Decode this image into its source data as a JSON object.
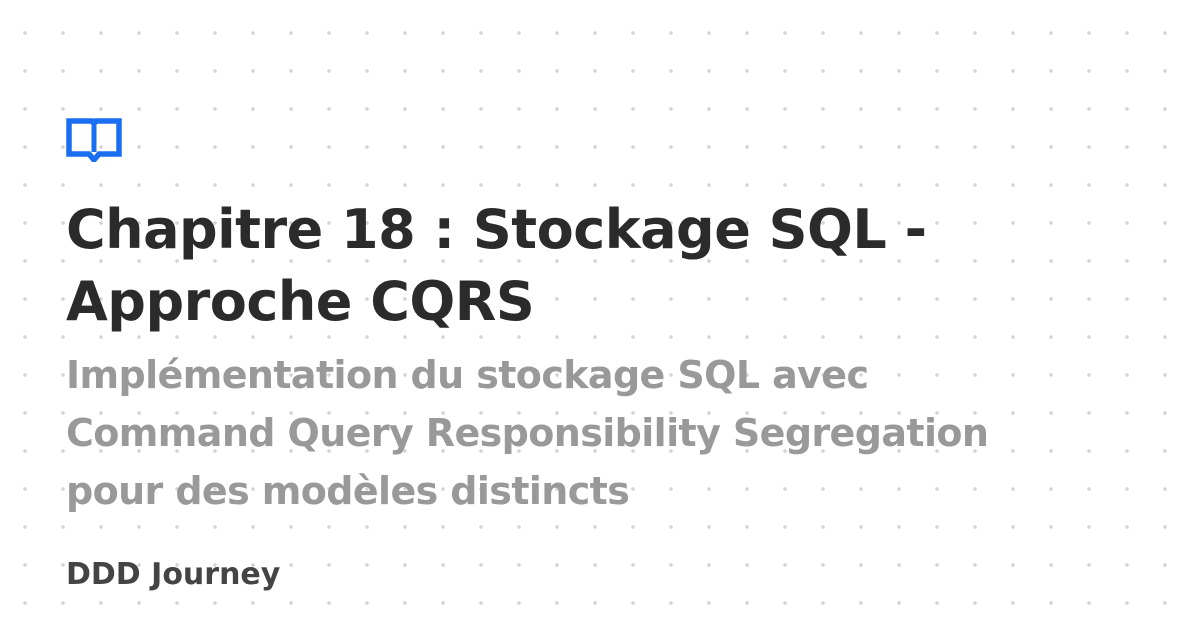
{
  "card": {
    "title": "Chapitre 18 : Stockage SQL -\nApproche CQRS",
    "subtitle": "Implémentation du stockage SQL avec\nCommand Query Responsibility Segregation\npour des modèles distincts",
    "site_name": "DDD Journey",
    "logo_icon": "open-book-icon",
    "colors": {
      "background": "#ffffff",
      "dots": "#d3d3d3",
      "title": "#2b2b2b",
      "subtitle": "#999999",
      "site_name": "#444444",
      "logo": "#1a6ef0"
    }
  }
}
